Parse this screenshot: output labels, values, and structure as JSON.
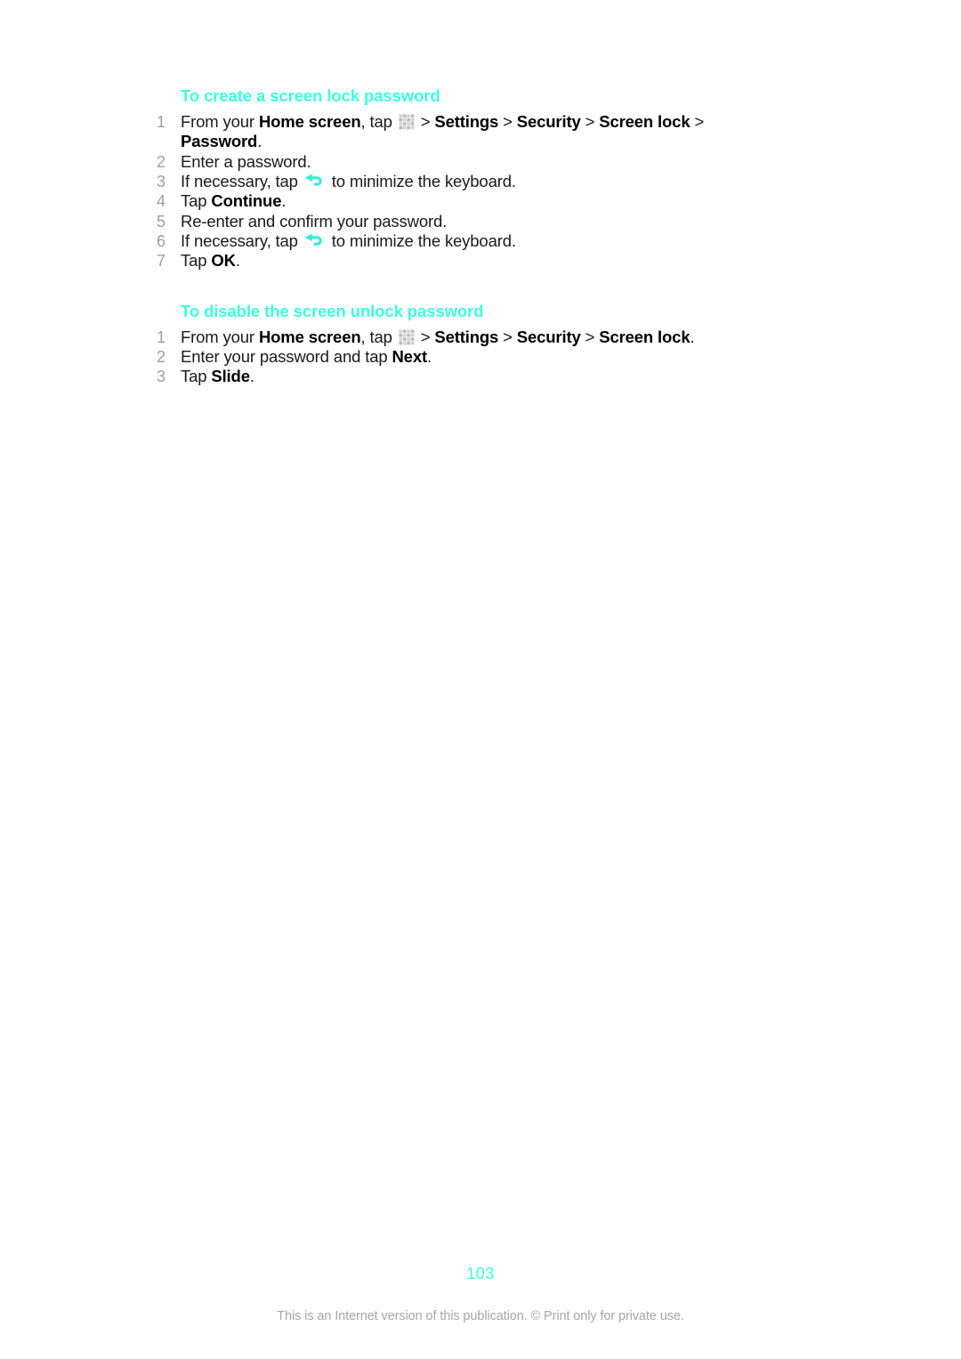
{
  "document": {
    "page_number": "103",
    "footer_note": "This is an Internet version of this publication. © Print only for private use.",
    "accent_color": "#3dffe0",
    "text_color": "#1a1a1a",
    "number_color": "#9e9e9e",
    "footer_color": "#a6a6a6",
    "background_color": "#ffffff"
  },
  "sections": [
    {
      "heading": "To create a screen lock password",
      "steps": [
        {
          "number": "1",
          "parts": [
            {
              "text": "From your ",
              "bold": false
            },
            {
              "text": "Home screen",
              "bold": true
            },
            {
              "text": ", tap ",
              "bold": false
            },
            {
              "icon": "app-grid-icon"
            },
            {
              "text": " > ",
              "bold": false
            },
            {
              "text": "Settings",
              "bold": true
            },
            {
              "text": " > ",
              "bold": false
            },
            {
              "text": "Security",
              "bold": true
            },
            {
              "text": " > ",
              "bold": false
            },
            {
              "text": "Screen lock",
              "bold": true
            },
            {
              "text": " > ",
              "bold": false
            },
            {
              "text": "Password",
              "bold": true
            },
            {
              "text": ".",
              "bold": false
            }
          ]
        },
        {
          "number": "2",
          "parts": [
            {
              "text": "Enter a password.",
              "bold": false
            }
          ]
        },
        {
          "number": "3",
          "parts": [
            {
              "text": "If necessary, tap ",
              "bold": false
            },
            {
              "icon": "back-arrow-icon"
            },
            {
              "text": " to minimize the keyboard.",
              "bold": false
            }
          ]
        },
        {
          "number": "4",
          "parts": [
            {
              "text": "Tap ",
              "bold": false
            },
            {
              "text": "Continue",
              "bold": true
            },
            {
              "text": ".",
              "bold": false
            }
          ]
        },
        {
          "number": "5",
          "parts": [
            {
              "text": "Re-enter and confirm your password.",
              "bold": false
            }
          ]
        },
        {
          "number": "6",
          "parts": [
            {
              "text": "If necessary, tap ",
              "bold": false
            },
            {
              "icon": "back-arrow-icon"
            },
            {
              "text": " to minimize the keyboard.",
              "bold": false
            }
          ]
        },
        {
          "number": "7",
          "parts": [
            {
              "text": "Tap ",
              "bold": false
            },
            {
              "text": "OK",
              "bold": true
            },
            {
              "text": ".",
              "bold": false
            }
          ]
        }
      ]
    },
    {
      "heading": "To disable the screen unlock password",
      "steps": [
        {
          "number": "1",
          "parts": [
            {
              "text": "From your ",
              "bold": false
            },
            {
              "text": "Home screen",
              "bold": true
            },
            {
              "text": ", tap ",
              "bold": false
            },
            {
              "icon": "app-grid-icon"
            },
            {
              "text": " > ",
              "bold": false
            },
            {
              "text": "Settings",
              "bold": true
            },
            {
              "text": " > ",
              "bold": false
            },
            {
              "text": "Security",
              "bold": true
            },
            {
              "text": " > ",
              "bold": false
            },
            {
              "text": "Screen lock",
              "bold": true
            },
            {
              "text": ".",
              "bold": false
            }
          ]
        },
        {
          "number": "2",
          "parts": [
            {
              "text": "Enter your password and tap ",
              "bold": false
            },
            {
              "text": "Next",
              "bold": true
            },
            {
              "text": ".",
              "bold": false
            }
          ]
        },
        {
          "number": "3",
          "parts": [
            {
              "text": "Tap ",
              "bold": false
            },
            {
              "text": "Slide",
              "bold": true
            },
            {
              "text": ".",
              "bold": false
            }
          ]
        }
      ]
    }
  ]
}
